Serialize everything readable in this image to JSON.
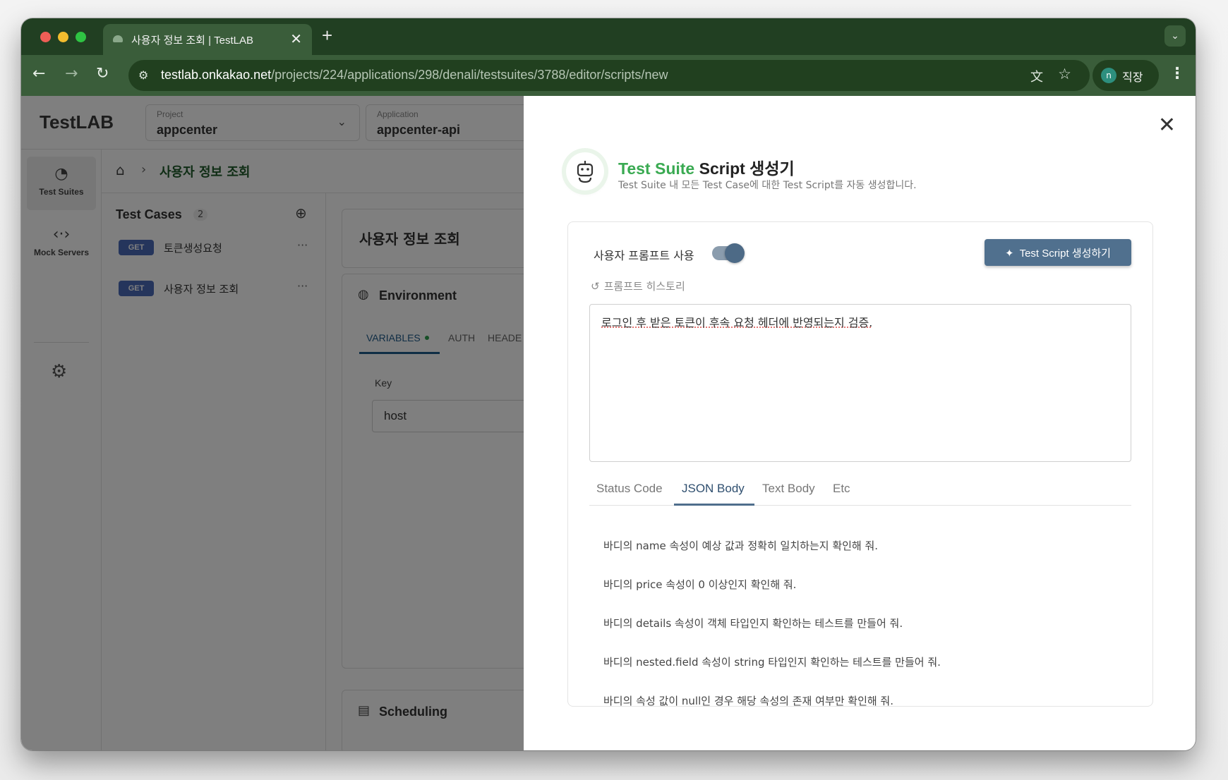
{
  "browser": {
    "tab_title": "사용자 정보 조회 | TestLAB",
    "tab_close": "✕",
    "new_tab": "+",
    "url_host": "testlab.onkakao.net",
    "url_path": "/projects/224/applications/298/denali/testsuites/3788/editor/scripts/new",
    "profile_initial": "n",
    "profile_name": "직장"
  },
  "app": {
    "logo": "TestLAB",
    "project": {
      "label": "Project",
      "value": "appcenter"
    },
    "application": {
      "label": "Application",
      "value": "appcenter-api"
    },
    "rail": [
      {
        "label": "Test Suites"
      },
      {
        "label": "Mock Servers"
      }
    ],
    "breadcrumb": {
      "current": "사용자 정보 조회"
    },
    "test_cases": {
      "title": "Test Cases",
      "count": "2",
      "items": [
        {
          "method": "GET",
          "name": "토큰생성요청"
        },
        {
          "method": "GET",
          "name": "사용자 정보 조회"
        }
      ]
    },
    "detail": {
      "title": "사용자 정보 조회",
      "environment": {
        "title": "Environment",
        "tabs": [
          "VARIABLES",
          "AUTH",
          "HEADE"
        ],
        "key_label": "Key",
        "key_value": "host"
      },
      "scheduling_title": "Scheduling"
    }
  },
  "drawer": {
    "title_accent": "Test Suite",
    "title_rest": " Script 생성기",
    "subtitle": "Test Suite 내 모든 Test Case에 대한 Test Script를 자동 생성합니다.",
    "toggle_label": "사용자 프롬프트 사용",
    "toggle_on": true,
    "generate_button": "Test Script 생성하기",
    "history_label": "프롬프트 히스토리",
    "prompt_text": "로그인 후 받은 토큰이 후속 요청 헤더에 반영되는지 검증.",
    "tabs": [
      "Status Code",
      "JSON Body",
      "Text Body",
      "Etc"
    ],
    "active_tab": "JSON Body",
    "suggestions": [
      "바디의 name 속성이 예상 값과 정확히 일치하는지 확인해 줘.",
      "바디의 price 속성이 0 이상인지 확인해 줘.",
      "바디의 details 속성이 객체 타입인지 확인하는 테스트를 만들어 줘.",
      "바디의 nested.field 속성이 string 타입인지 확인하는 테스트를 만들어 줘.",
      "바디의 속성 값이 null인 경우 해당 속성의 존재 여부만 확인해 줘."
    ]
  },
  "colors": {
    "browser_frame": "#213f22",
    "browser_toolbar": "#3a5d3a",
    "accent_green": "#3aaa52",
    "button_slate": "#50708e",
    "method_badge": "#4a6ab8"
  }
}
